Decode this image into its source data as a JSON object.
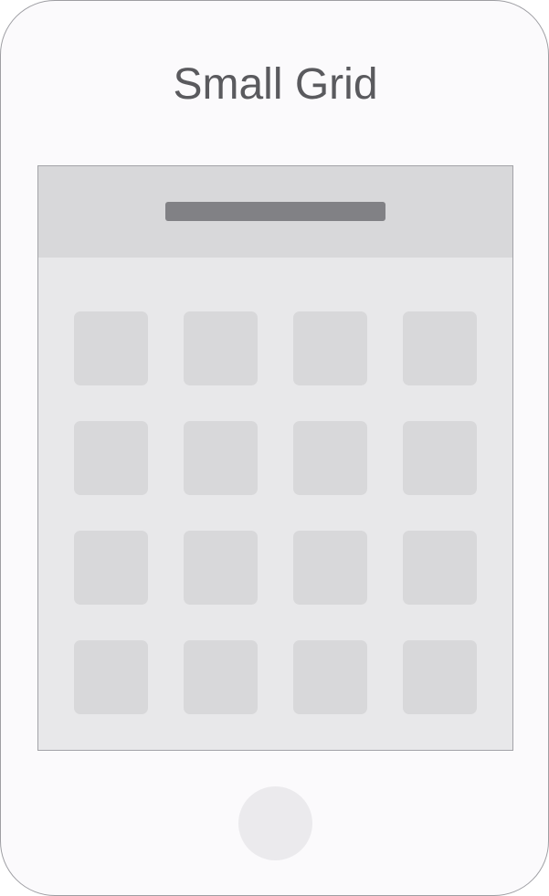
{
  "title": "Small Grid",
  "screen": {
    "grid": {
      "rows": 4,
      "columns": 4
    }
  },
  "colors": {
    "device_body": "#fbfafc",
    "device_outline": "#9e9ea3",
    "screen_background": "#e8e8ea",
    "screen_header": "#d8d8da",
    "header_bar": "#818185",
    "grid_tile": "#d8d8da",
    "home_button": "#ebeaed",
    "title_text": "#5a5a5e"
  }
}
